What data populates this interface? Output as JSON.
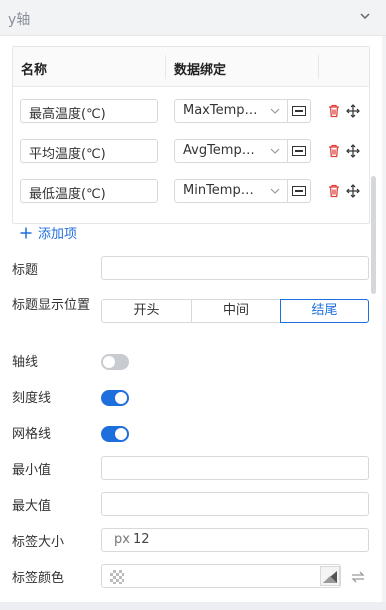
{
  "section": {
    "title": "y轴"
  },
  "table": {
    "headers": {
      "name": "名称",
      "binding": "数据绑定"
    },
    "rows": [
      {
        "name": "最高温度(℃)",
        "binding": "MaxTemperature"
      },
      {
        "name": "平均温度(℃)",
        "binding": "AvgTemperature"
      },
      {
        "name": "最低温度(℃)",
        "binding": "MinTemperature"
      }
    ]
  },
  "add_item_label": "添加项",
  "form": {
    "title": {
      "label": "标题",
      "value": ""
    },
    "title_position": {
      "label": "标题显示位置",
      "options": [
        "开头",
        "中间",
        "结尾"
      ],
      "selected": "结尾"
    },
    "axis_line": {
      "label": "轴线",
      "enabled": false
    },
    "tick_line": {
      "label": "刻度线",
      "enabled": true
    },
    "grid_line": {
      "label": "网格线",
      "enabled": true
    },
    "min_value": {
      "label": "最小值",
      "value": ""
    },
    "max_value": {
      "label": "最大值",
      "value": ""
    },
    "label_size": {
      "label": "标签大小",
      "unit": "px",
      "value": "12"
    },
    "label_color": {
      "label": "标签颜色"
    }
  },
  "colors": {
    "accent": "#1e6fde",
    "delete": "#e0413a",
    "toggle_off": "#c8cbd0"
  },
  "icons": [
    "chevron-down-icon",
    "delete-icon",
    "move-icon",
    "plus-icon",
    "color-picker-icon",
    "swap-icon",
    "bind-field-icon"
  ]
}
